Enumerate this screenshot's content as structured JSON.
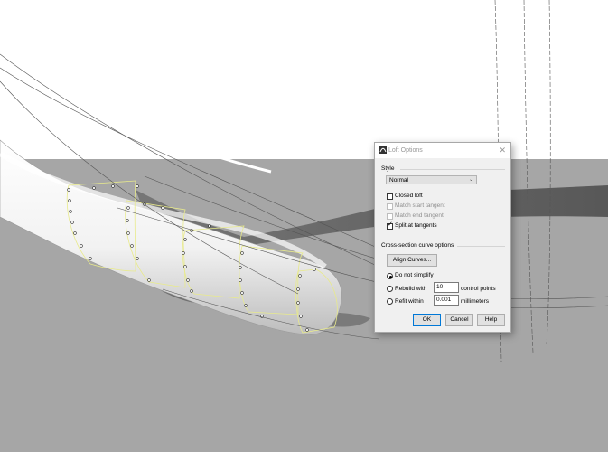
{
  "dialog": {
    "title": "Loft Options",
    "close_glyph": "✕",
    "icon": "rhino-loft-icon",
    "style_section": {
      "heading": "Style",
      "selected": "Normal",
      "options": [
        {
          "label": "Closed loft",
          "checked": false,
          "enabled": true
        },
        {
          "label": "Match start tangent",
          "checked": false,
          "enabled": false
        },
        {
          "label": "Match end tangent",
          "checked": false,
          "enabled": false
        },
        {
          "label": "Split at tangents",
          "checked": true,
          "enabled": true
        }
      ]
    },
    "cross_section": {
      "heading": "Cross-section curve options",
      "align_button": "Align Curves...",
      "radio_1": "Do not simplify",
      "radio_2_prefix": "Rebuild with",
      "radio_2_value": "10",
      "radio_2_suffix": "control points",
      "radio_3_prefix": "Refit within",
      "radio_3_value": "0.001",
      "radio_3_suffix": "millimeters",
      "selected_radio": "Do not simplify"
    },
    "buttons": {
      "ok": "OK",
      "cancel": "Cancel",
      "help": "Help"
    }
  },
  "colors": {
    "viewport_sky": "#ffffff",
    "viewport_ground": "#a6a6a6",
    "curve_highlight": "#e8ea8c"
  }
}
